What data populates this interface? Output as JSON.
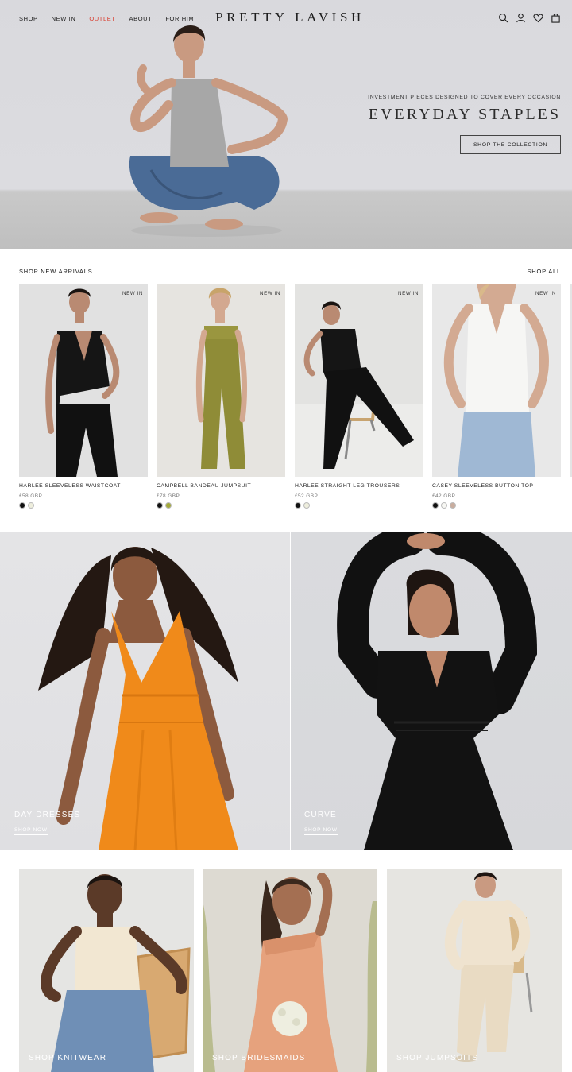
{
  "header": {
    "nav": [
      "SHOP",
      "NEW IN",
      "OUTLET",
      "ABOUT",
      "FOR HIM"
    ],
    "logo": "PRETTY LAVISH",
    "icons": [
      "search-icon",
      "account-icon",
      "wishlist-icon",
      "bag-icon"
    ]
  },
  "hero": {
    "kicker": "INVESTMENT PIECES DESIGNED TO COVER EVERY OCCASION",
    "title": "EVERYDAY STAPLES",
    "button": "SHOP THE COLLECTION"
  },
  "new_arrivals": {
    "heading": "SHOP NEW ARRIVALS",
    "shop_all": "SHOP ALL",
    "products": [
      {
        "badge": "NEW IN",
        "name": "HARLEE SLEEVELESS WAISTCOAT",
        "price": "£58 GBP",
        "swatches": [
          "#111111",
          "#eeeedd"
        ]
      },
      {
        "badge": "NEW IN",
        "name": "CAMPBELL BANDEAU JUMPSUIT",
        "price": "£78 GBP",
        "swatches": [
          "#111111",
          "#a4aa3a"
        ]
      },
      {
        "badge": "NEW IN",
        "name": "HARLEE STRAIGHT LEG TROUSERS",
        "price": "£52 GBP",
        "swatches": [
          "#111111",
          "#eeeedd"
        ]
      },
      {
        "badge": "NEW IN",
        "name": "CASEY SLEEVELESS BUTTON TOP",
        "price": "£42 GBP",
        "swatches": [
          "#111111",
          "#f7f7f3",
          "#c9ad9e"
        ]
      }
    ]
  },
  "banners": [
    {
      "title": "DAY DRESSES",
      "link": "SHOP NOW"
    },
    {
      "title": "CURVE",
      "link": "SHOP NOW"
    }
  ],
  "tiles": [
    "SHOP KNITWEAR",
    "SHOP BRIDESMAIDS",
    "SHOP JUMPSUITS"
  ],
  "colors": {
    "accent_outlet": "#d93a2b",
    "text": "#1a1a1a"
  }
}
